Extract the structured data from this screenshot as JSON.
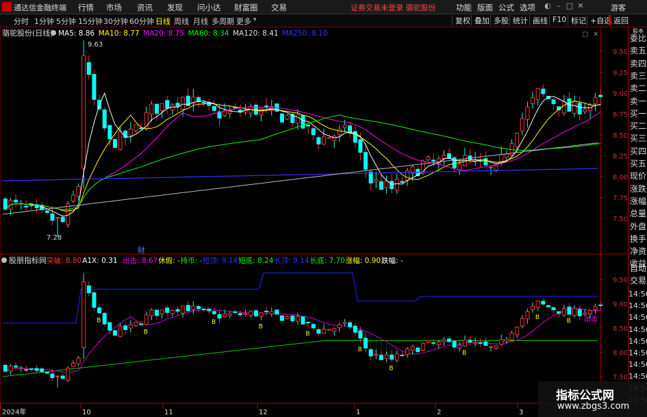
{
  "titlebar": {
    "app_name": "通达信金融终端",
    "menu": [
      "行情",
      "市场",
      "资讯",
      "发现",
      "问小达",
      "财富圈",
      "交易"
    ],
    "notice": "证券交易未登录  骆驼股份",
    "right_menu": [
      "功能",
      "版面",
      "公式",
      "选项"
    ],
    "guest": "游客"
  },
  "periodbar": {
    "tabs": [
      "分时",
      "1分钟",
      "5分钟",
      "15分钟",
      "30分钟",
      "60分钟",
      "日线",
      "周线",
      "月线",
      "多周期",
      "更多"
    ],
    "active_tab": "日线",
    "tools": [
      "复权",
      "叠加",
      "多股",
      "统计",
      "画线",
      "F10",
      "标记",
      "+自选",
      "返回"
    ]
  },
  "main_chart": {
    "title": "骆驼股份(日线)",
    "ma": [
      {
        "label": "MA5:",
        "value": "8.86",
        "color": "#ffffff"
      },
      {
        "label": "MA10:",
        "value": "8.77",
        "color": "#ffff00"
      },
      {
        "label": "MA20:",
        "value": "8.75",
        "color": "#ff00ff"
      },
      {
        "label": "MA60:",
        "value": "8.34",
        "color": "#00ff00"
      },
      {
        "label": "MA120:",
        "value": "8.41",
        "color": "#e0e0e0"
      },
      {
        "label": "MA250:",
        "value": "8.10",
        "color": "#3333ff"
      }
    ],
    "high_label": "9.63",
    "low_label": "7.28",
    "fin_marker": "财",
    "price_axis": [
      "9.50",
      "9.25",
      "9.00",
      "8.75",
      "8.50",
      "8.25",
      "8.00",
      "7.75",
      "7.50"
    ]
  },
  "indicator_chart": {
    "name": "股朋指标网",
    "fields": [
      {
        "label": "突破:",
        "value": "8.80",
        "color": "#ff3333"
      },
      {
        "label": "A1X:",
        "value": "0.31",
        "color": "#ffffff"
      },
      {
        "label": "出击:",
        "value": "8.67",
        "color": "#ff00ff"
      },
      {
        "label": "休假:",
        "value": "-",
        "color": "#ffff00"
      },
      {
        "label": "持币:",
        "value": "-",
        "color": "#00ff00"
      },
      {
        "label": "短顶:",
        "value": "9.14",
        "color": "#3333ff"
      },
      {
        "label": "短底:",
        "value": "8.24",
        "color": "#00ff00"
      },
      {
        "label": "长顶:",
        "value": "9.14",
        "color": "#3333ff"
      },
      {
        "label": "长底:",
        "value": "7.70",
        "color": "#00ff00"
      },
      {
        "label": "涨幅:",
        "value": "0.90",
        "color": "#ffff00"
      },
      {
        "label": "跌幅:",
        "value": "-",
        "color": "#ffffff"
      }
    ],
    "price_axis": [
      "9.50",
      "9.00",
      "8.50",
      "8.00",
      "7.50"
    ],
    "attack_label": "出击"
  },
  "time_axis": [
    "2024年",
    "10",
    "11",
    "12",
    "1",
    "2",
    "3"
  ],
  "sidepanel": {
    "top_label": "股本",
    "items": [
      "委比",
      "卖五",
      "卖四",
      "卖三",
      "卖二",
      "卖一",
      "买一",
      "买二",
      "买三",
      "买四",
      "买五",
      "现价",
      "涨跌",
      "涨幅",
      "总量",
      "外盘",
      "换手",
      "净资",
      "收益"
    ],
    "auto": "自动",
    "trade": "交易",
    "times": [
      "14:56",
      "14:56",
      "14:56",
      "14:56",
      "14:56",
      "14:56",
      "14:56",
      "14:56",
      "14:56",
      "14:56"
    ]
  },
  "watermark": {
    "line1": "指标公式网",
    "line2": "www.zbgs3.com"
  }
}
